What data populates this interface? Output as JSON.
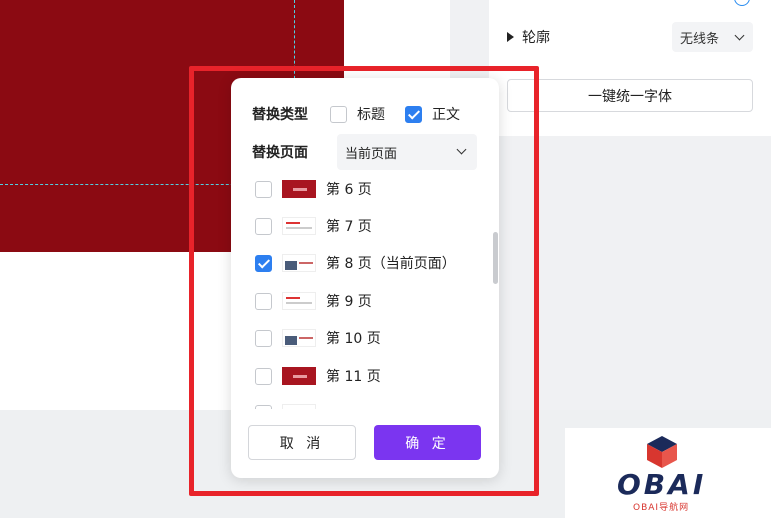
{
  "right_panel": {
    "outline_label": "轮廓",
    "outline_value": "无线条",
    "unify_font_label": "一键统一字体"
  },
  "dialog": {
    "type_label": "替换类型",
    "type_options": [
      {
        "label": "标题",
        "checked": false
      },
      {
        "label": "正文",
        "checked": true
      }
    ],
    "page_label": "替换页面",
    "page_value": "当前页面",
    "pages": [
      {
        "label": "第 6 页",
        "checked": false,
        "thumb": "red"
      },
      {
        "label": "第 7 页",
        "checked": false,
        "thumb": "lines"
      },
      {
        "label": "第 8 页（当前页面）",
        "checked": true,
        "thumb": "pic"
      },
      {
        "label": "第 9 页",
        "checked": false,
        "thumb": "lines"
      },
      {
        "label": "第 10 页",
        "checked": false,
        "thumb": "pic"
      },
      {
        "label": "第 11 页",
        "checked": false,
        "thumb": "red"
      }
    ],
    "cancel_label": "取 消",
    "confirm_label": "确 定"
  },
  "watermark": {
    "text": "OBAI",
    "subtext": "OBAI导航网"
  },
  "colors": {
    "slide": "#8b0a12",
    "primary": "#7b35f0",
    "checkbox": "#2d7ff0",
    "highlight": "#e8232a"
  }
}
